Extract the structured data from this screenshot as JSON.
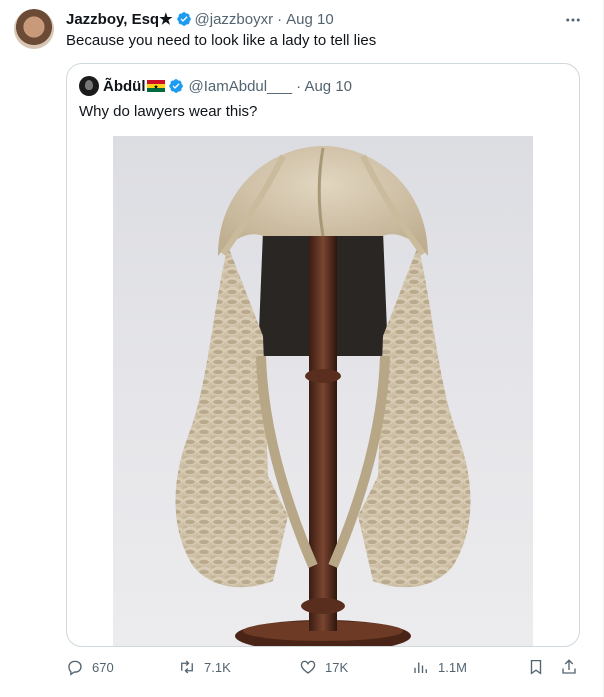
{
  "tweet": {
    "author_name": "Jazzboy, Esq★",
    "handle": "@jazzboyxr",
    "separator": "·",
    "date": "Aug 10",
    "text": "Because you need to look like a lady to tell lies"
  },
  "quoted": {
    "author_name": "Ãbdül",
    "handle": "@IamAbdul___",
    "date": "· Aug 10",
    "text": "Why do lawyers wear this?",
    "flag_colors": [
      "#ce1126",
      "#fcd116",
      "#006b3f"
    ]
  },
  "actions": {
    "replies": "670",
    "reposts": "7.1K",
    "likes": "17K",
    "views": "1.1M"
  },
  "colors": {
    "verified": "#1d9bf0",
    "muted_text": "#536471",
    "border": "#cfd9de"
  }
}
